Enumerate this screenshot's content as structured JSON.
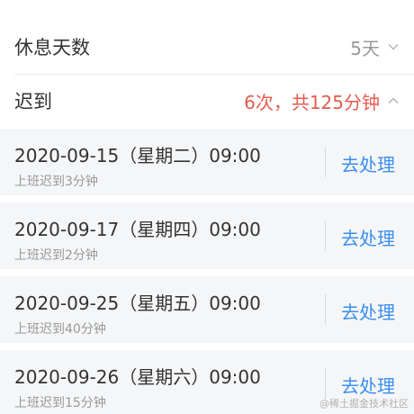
{
  "summary_rows": [
    {
      "label": "休息天数",
      "value": "5天"
    },
    {
      "label": "迟到",
      "value": "6次，共125分钟"
    }
  ],
  "late_records": [
    {
      "datetime": "2020-09-15（星期二）09:00",
      "desc": "上班迟到3分钟",
      "action": "去处理"
    },
    {
      "datetime": "2020-09-17（星期四）09:00",
      "desc": "上班迟到2分钟",
      "action": "去处理"
    },
    {
      "datetime": "2020-09-25（星期五）09:00",
      "desc": "上班迟到40分钟",
      "action": "去处理"
    },
    {
      "datetime": "2020-09-26（星期六）09:00",
      "desc": "上班迟到15分钟",
      "action": "去处理"
    }
  ],
  "watermark": "@稀土掘金技术社区",
  "colors": {
    "accent_blue": "#3b8ff0",
    "late_red": "#e55b50",
    "muted": "#999999"
  },
  "icons": {
    "collapsed": "chevron-down-icon",
    "expanded": "chevron-up-icon"
  }
}
